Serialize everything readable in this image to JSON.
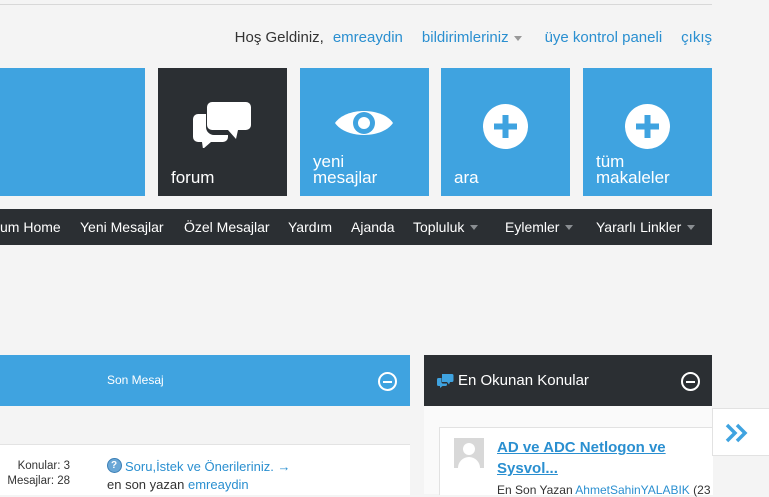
{
  "userbar": {
    "greeting": "Hoş Geldiniz,",
    "username": "emreaydin",
    "notifications": "bildirimleriniz",
    "control_panel": "üye kontrol paneli",
    "logout": "çıkış"
  },
  "tiles": {
    "forum": "forum",
    "new_posts_line1": "yeni",
    "new_posts_line2": "mesajlar",
    "search": "ara",
    "articles_line1": "tüm",
    "articles_line2": "makaleler"
  },
  "nav": {
    "items": [
      "um Home",
      "Yeni Mesajlar",
      "Özel Mesajlar",
      "Yardım",
      "Ajanda",
      "Topluluk",
      "Eylemler",
      "Yararlı Linkler"
    ]
  },
  "left_panel": {
    "header": "Son Mesaj",
    "topics_label": "Konular: 3",
    "posts_label": "Mesajlar: 28",
    "last_post_title": "Soru,İstek ve Önerileriniz.",
    "last_post_by": "en son yazan",
    "last_post_user": "emreaydin"
  },
  "right_panel": {
    "header": "En Okunan Konular",
    "item_title": "AD ve ADC Netlogon ve Sysvol...",
    "item_meta_prefix": "En Son Yazan",
    "item_meta_user": "AhmetSahinYALABIK",
    "item_meta_suffix": "(23"
  },
  "colors": {
    "accent": "#3fa3e0",
    "dark": "#2b2f33",
    "link": "#2a8fd0",
    "background": "#f4f4f4"
  }
}
